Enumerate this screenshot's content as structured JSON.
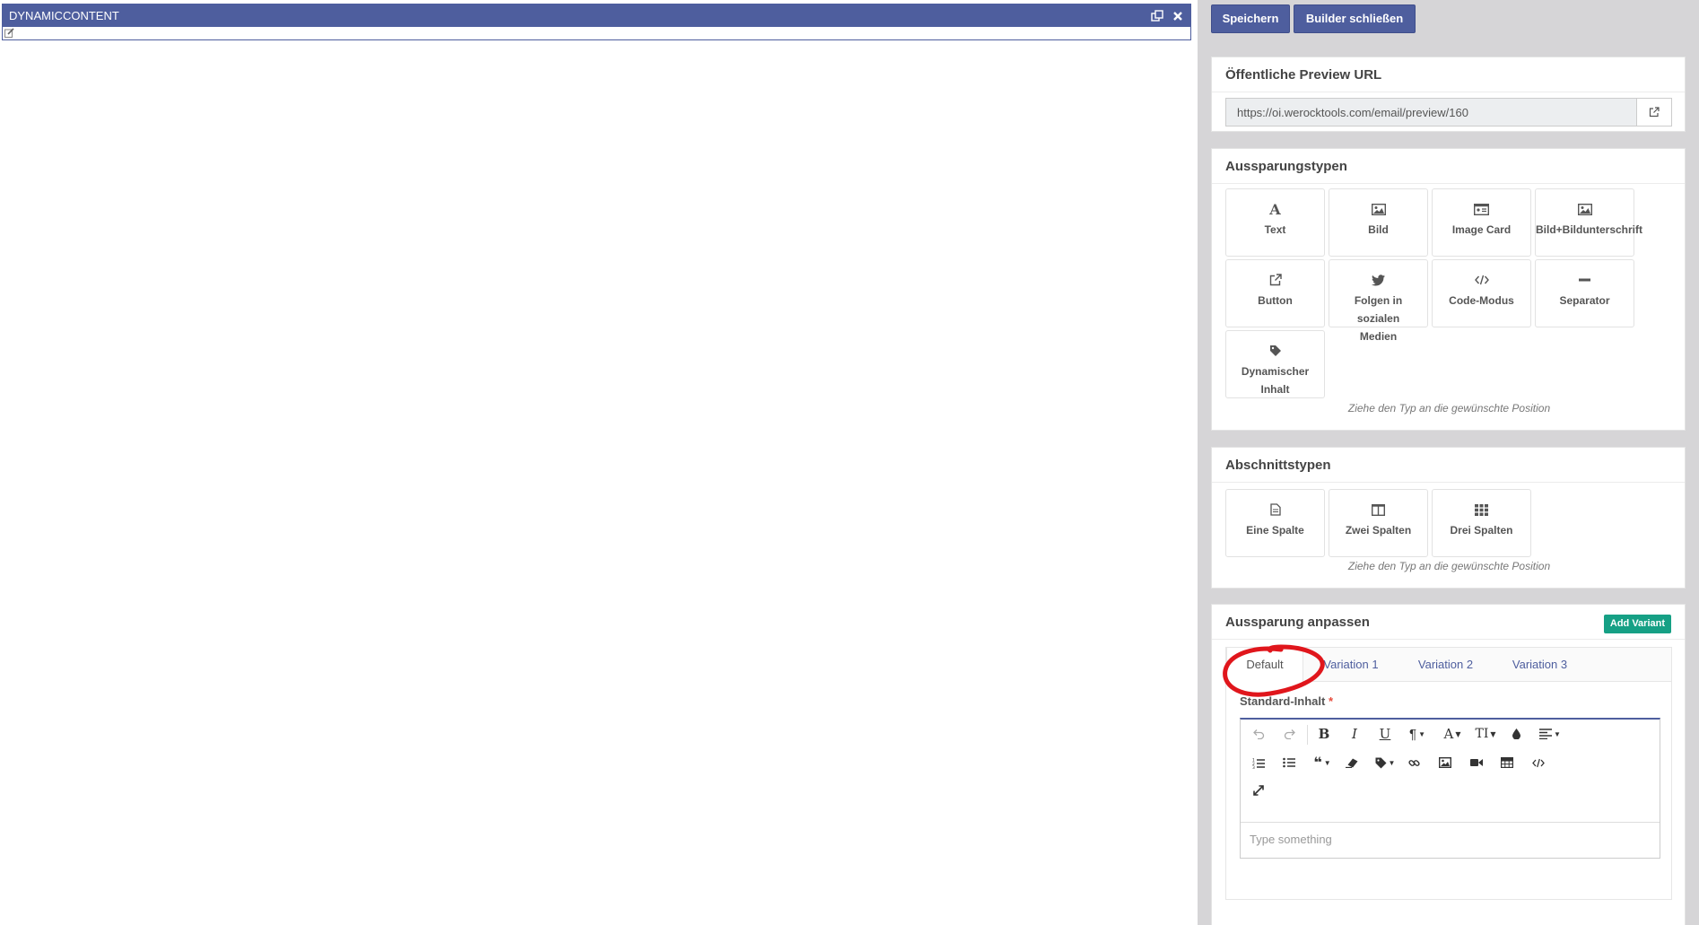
{
  "canvas": {
    "block_title": "DYNAMICCONTENT",
    "icons": [
      "clone-icon",
      "close-icon",
      "edit-icon"
    ]
  },
  "toolbar": {
    "save_label": "Speichern",
    "close_label": "Builder schließen"
  },
  "preview": {
    "title": "Öffentliche Preview URL",
    "url": "https://oi.werocktools.com/email/preview/160"
  },
  "slot_types": {
    "title": "Aussparungstypen",
    "items": [
      {
        "label": "Text",
        "icon": "font-icon"
      },
      {
        "label": "Bild",
        "icon": "image-icon"
      },
      {
        "label": "Image Card",
        "icon": "id-card-icon"
      },
      {
        "label": "Bild+Bildunterschrift",
        "icon": "image-icon"
      },
      {
        "label": "Button",
        "icon": "external-link-icon"
      },
      {
        "label": "Folgen in sozialen Medien",
        "icon": "twitter-icon"
      },
      {
        "label": "Code-Modus",
        "icon": "code-icon"
      },
      {
        "label": "Separator",
        "icon": "minus-icon"
      },
      {
        "label": "Dynamischer Inhalt",
        "icon": "tag-icon"
      }
    ],
    "hint": "Ziehe den Typ an die gewünschte Position"
  },
  "section_types": {
    "title": "Abschnittstypen",
    "items": [
      {
        "label": "Eine Spalte",
        "icon": "file-icon"
      },
      {
        "label": "Zwei Spalten",
        "icon": "columns-icon"
      },
      {
        "label": "Drei Spalten",
        "icon": "grid-icon"
      }
    ],
    "hint": "Ziehe den Typ an die gewünschte Position"
  },
  "customize": {
    "title": "Aussparung anpassen",
    "add_variant": "Add Variant",
    "tabs": [
      "Default",
      "Variation 1",
      "Variation 2",
      "Variation 3"
    ],
    "active_tab": "Default",
    "field_label": "Standard-Inhalt",
    "required_mark": "*",
    "editor_placeholder": "Type something"
  },
  "colors": {
    "primary": "#4e5e9e",
    "success": "#16a085",
    "annotation": "#e0161c"
  }
}
